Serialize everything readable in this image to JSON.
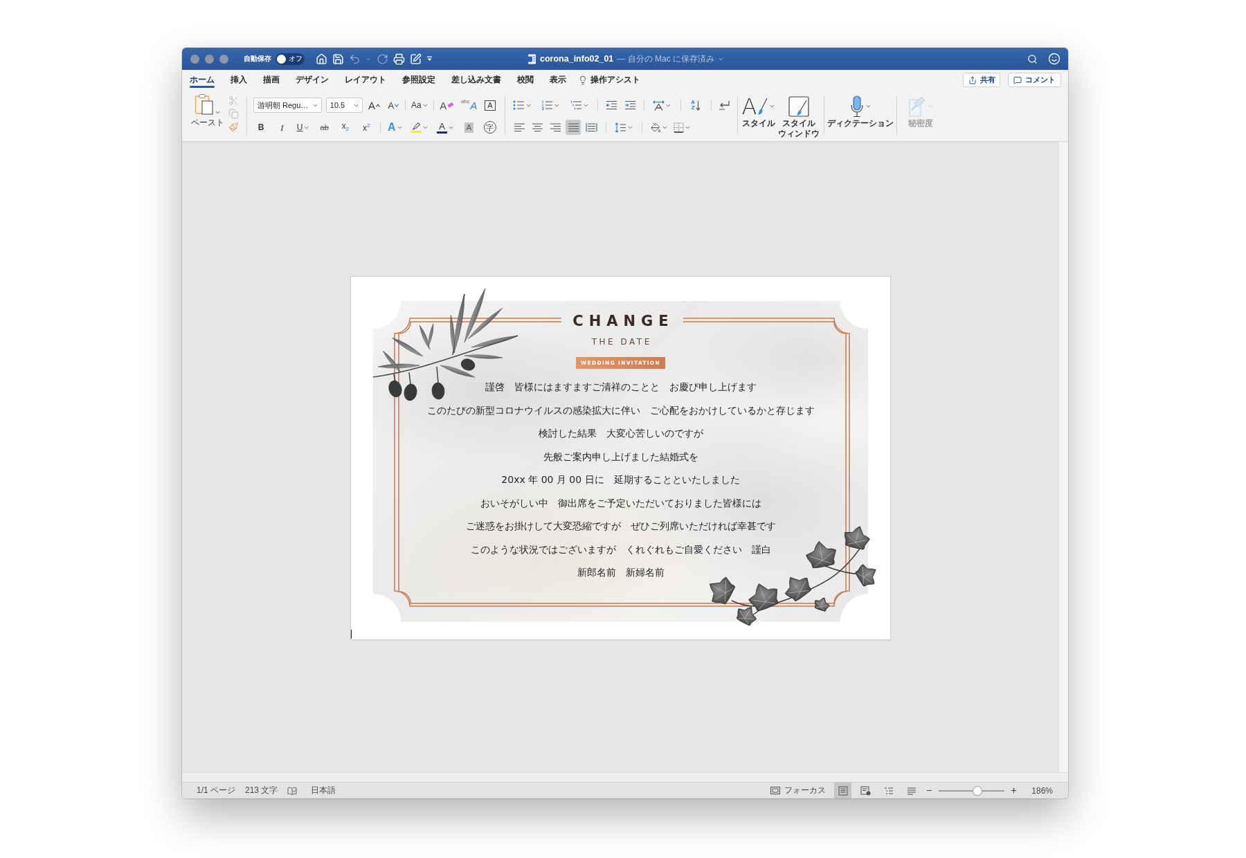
{
  "window": {
    "autosave": {
      "label": "自動保存",
      "state": "オフ",
      "on": false
    },
    "quick_access": [
      {
        "kind": "home",
        "disabled": false
      },
      {
        "kind": "save",
        "disabled": false
      },
      {
        "kind": "undo",
        "disabled": true
      },
      {
        "kind": "redo",
        "disabled": true
      },
      {
        "kind": "print",
        "disabled": false
      },
      {
        "kind": "edit",
        "disabled": false
      }
    ],
    "title": "corona_info02_01",
    "save_status": "— 自分の Mac に保存済み"
  },
  "tabs": [
    {
      "label": "ホーム",
      "selected": true
    },
    {
      "label": "挿入",
      "selected": false
    },
    {
      "label": "描画",
      "selected": false
    },
    {
      "label": "デザイン",
      "selected": false
    },
    {
      "label": "レイアウト",
      "selected": false
    },
    {
      "label": "参照設定",
      "selected": false
    },
    {
      "label": "差し込み文書",
      "selected": false
    },
    {
      "label": "校閲",
      "selected": false
    },
    {
      "label": "表示",
      "selected": false
    }
  ],
  "assist": {
    "label": "操作アシスト"
  },
  "actions": {
    "share": "共有",
    "comment": "コメント"
  },
  "ribbon": {
    "clipboard": {
      "paste": "ペースト",
      "tools": [
        {
          "kind": "cut",
          "disabled": true
        },
        {
          "kind": "copy",
          "disabled": true
        },
        {
          "kind": "format_painter",
          "disabled": false
        }
      ]
    },
    "font": {
      "name": "游明朝 Regu…",
      "size": "10.5",
      "row1": [
        {
          "kind": "grow",
          "label": "A"
        },
        {
          "kind": "shrink",
          "label": "A"
        },
        {
          "kind": "case",
          "label": "Aa"
        },
        {
          "kind": "clear",
          "label": "A"
        },
        {
          "kind": "phonetic",
          "ruby": "abc",
          "label": "A"
        },
        {
          "kind": "boxed",
          "label": "A"
        }
      ],
      "row2": [
        {
          "kind": "bold",
          "label": "B"
        },
        {
          "kind": "italic",
          "label": "I"
        },
        {
          "kind": "underline",
          "label": "U"
        },
        {
          "kind": "strike",
          "label": "ab"
        },
        {
          "kind": "subscript",
          "label": "x$_{2}$"
        },
        {
          "kind": "superscript",
          "label": "x$^{2}$"
        },
        {
          "kind": "effects",
          "label": "A"
        },
        {
          "kind": "highlight",
          "color": "#fff200"
        },
        {
          "kind": "font_color",
          "label": "A",
          "color": "#1f2a6e"
        },
        {
          "kind": "shading",
          "label": "A"
        },
        {
          "kind": "enclosed",
          "label": "字"
        }
      ]
    },
    "paragraph": {
      "sort": {
        "top": "A",
        "bottom": "Z"
      },
      "alignments": [
        {
          "kind": "left",
          "selected": false
        },
        {
          "kind": "center",
          "selected": false
        },
        {
          "kind": "right",
          "selected": false
        },
        {
          "kind": "justify",
          "selected": true
        },
        {
          "kind": "distributed",
          "selected": false
        }
      ]
    },
    "styles": {
      "glyph": "A",
      "label": "スタイル"
    },
    "style_window": {
      "lines": [
        "スタイル",
        "ウィンドウ"
      ]
    },
    "dictation": {
      "label": "ディクテーション"
    },
    "sensitivity": {
      "label": "秘密度",
      "disabled": true
    }
  },
  "document": {
    "heading": "CHANGE",
    "subheading": "THE DATE",
    "badge": "WEDDING INVITATION",
    "lines": [
      "謹啓　皆様にはますますご清祥のことと　お慶び申し上げます",
      "このたびの新型コロナウイルスの感染拡大に伴い　ご心配をおかけしているかと存じます",
      "検討した結果　大変心苦しいのですが",
      "先般ご案内申し上げました結婚式を",
      "20xx 年 00 月 00 日に　延期することといたしました",
      "おいそがしい中　御出席をご予定いただいておりました皆様には",
      "ご迷惑をお掛けして大変恐縮ですが　ぜひご列席いただければ幸甚です",
      "このような状況ではございますが　くれぐれもご自愛ください　謹白",
      "新郎名前　新婦名前"
    ]
  },
  "status_bar": {
    "pages": "1/1 ページ",
    "words": "213 文字",
    "language": "日本語",
    "focus": "フォーカス",
    "views": [
      {
        "kind": "print",
        "selected": true
      },
      {
        "kind": "web",
        "selected": false
      },
      {
        "kind": "outline",
        "selected": false
      },
      {
        "kind": "draft",
        "selected": false
      }
    ],
    "zoom": {
      "level": 0.6,
      "reading": "186%"
    }
  }
}
